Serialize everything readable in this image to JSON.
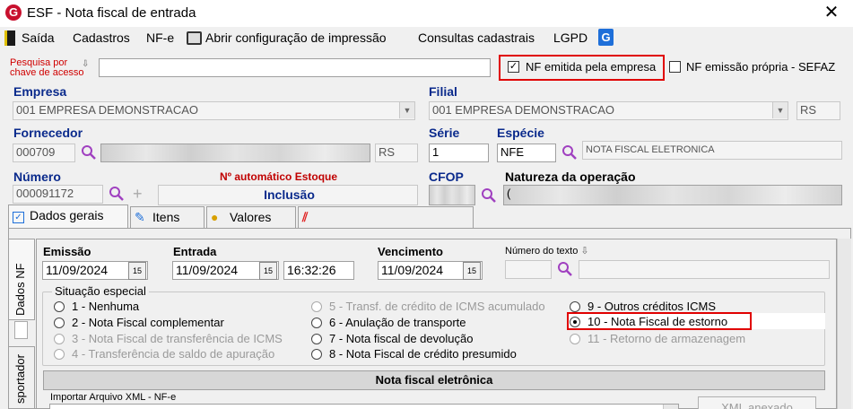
{
  "window": {
    "title": "ESF - Nota fiscal de entrada",
    "app_icon_letter": "G"
  },
  "menu": {
    "items": [
      "Saída",
      "Cadastros",
      "NF-e",
      "Abrir configuração de impressão",
      "Consultas cadastrais",
      "LGPD"
    ]
  },
  "search": {
    "label_line1": "Pesquisa por",
    "label_line2": "chave de acesso",
    "value": ""
  },
  "flags": {
    "nf_emitida_label": "NF emitida pela empresa",
    "nf_emitida_checked": true,
    "nf_propria_label": "NF emissão própria - SEFAZ",
    "nf_propria_checked": false
  },
  "empresa": {
    "label": "Empresa",
    "value": "001 EMPRESA DEMONSTRACAO"
  },
  "filial": {
    "label": "Filial",
    "value": "001 EMPRESA DEMONSTRACAO",
    "uf": "RS"
  },
  "fornecedor": {
    "label": "Fornecedor",
    "code": "000709",
    "uf": "RS"
  },
  "serie": {
    "label": "Série",
    "value": "1"
  },
  "especie": {
    "label": "Espécie",
    "code": "NFE",
    "description": "NOTA FISCAL ELETRONICA"
  },
  "numero": {
    "label": "Número",
    "value": "000091172"
  },
  "estoque": {
    "label": "Nº automático Estoque",
    "mode": "Inclusão"
  },
  "cfop": {
    "label": "CFOP"
  },
  "natureza": {
    "label": "Natureza da operação",
    "value": "("
  },
  "tabs": [
    "Dados gerais",
    "Itens",
    "Valores",
    ""
  ],
  "side_tabs": [
    "Dados NF",
    "sportador"
  ],
  "dates": {
    "emissao_label": "Emissão",
    "emissao": "11/09/2024",
    "entrada_label": "Entrada",
    "entrada": "11/09/2024",
    "entrada_hora": "16:32:26",
    "vencimento_label": "Vencimento",
    "vencimento": "11/09/2024",
    "numero_texto_label": "Número do texto",
    "cal_icon": "15"
  },
  "situacao": {
    "label": "Situação especial",
    "options": [
      {
        "label": "1 - Nenhuma",
        "enabled": true,
        "selected": false
      },
      {
        "label": "2 - Nota Fiscal complementar",
        "enabled": true,
        "selected": false
      },
      {
        "label": "3 - Nota Fiscal de transferência de ICMS",
        "enabled": false,
        "selected": false
      },
      {
        "label": "4 - Transferência de saldo de apuração",
        "enabled": false,
        "selected": false
      },
      {
        "label": "5 - Transf. de crédito de ICMS acumulado",
        "enabled": false,
        "selected": false
      },
      {
        "label": "6 - Anulação de transporte",
        "enabled": true,
        "selected": false
      },
      {
        "label": "7 - Nota fiscal de devolução",
        "enabled": true,
        "selected": false
      },
      {
        "label": "8 - Nota Fiscal de crédito presumido",
        "enabled": true,
        "selected": false
      },
      {
        "label": "9 - Outros créditos ICMS",
        "enabled": true,
        "selected": false
      },
      {
        "label": "10 - Nota Fiscal de estorno",
        "enabled": true,
        "selected": true
      },
      {
        "label": "11 - Retorno de armazenagem",
        "enabled": false,
        "selected": false
      }
    ]
  },
  "nfe": {
    "header": "Nota fiscal eletrônica",
    "import_label": "Importar Arquivo XML - NF-e",
    "button": "XML anexado"
  },
  "colors": {
    "accent_red": "#e00000",
    "label_blue": "#0a2a8c"
  }
}
